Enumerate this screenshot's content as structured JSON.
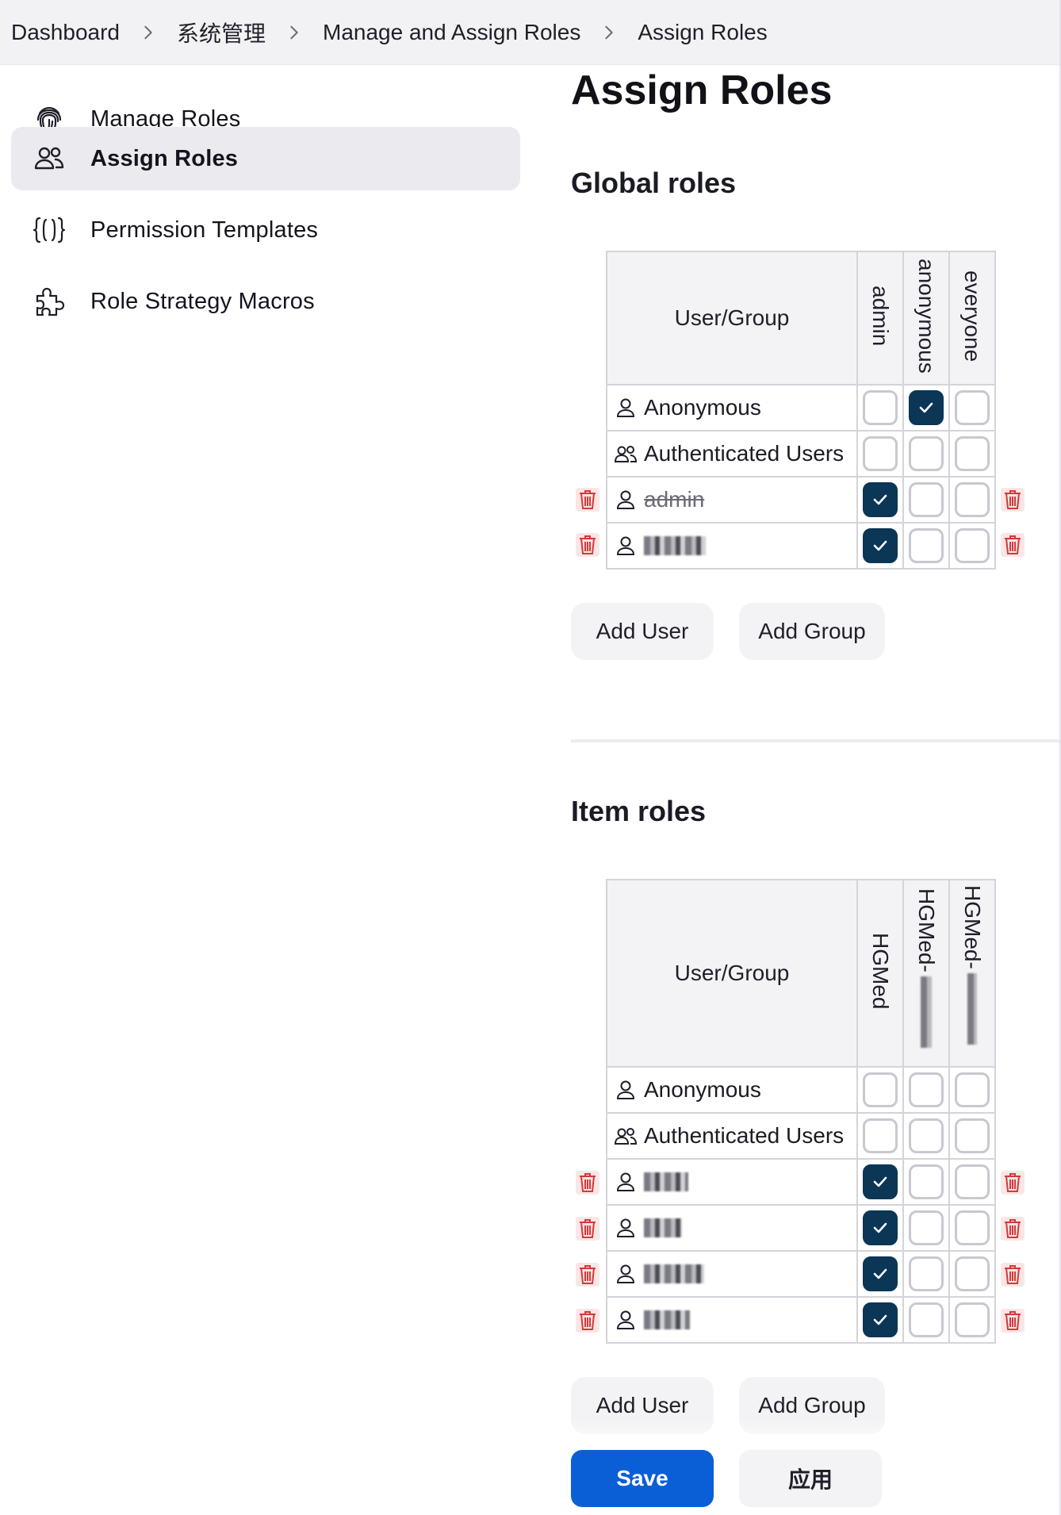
{
  "breadcrumb": {
    "items": [
      "Dashboard",
      "系统管理",
      "Manage and Assign Roles",
      "Assign Roles"
    ]
  },
  "sidebar": {
    "items": [
      {
        "label": "Manage Roles",
        "icon": "fingerprint-icon",
        "active": false
      },
      {
        "label": "Assign Roles",
        "icon": "users-icon",
        "active": true
      },
      {
        "label": "Permission Templates",
        "icon": "braces-icon",
        "active": false
      },
      {
        "label": "Role Strategy Macros",
        "icon": "puzzle-icon",
        "active": false
      }
    ]
  },
  "main": {
    "title": "Assign Roles",
    "global": {
      "title": "Global roles",
      "user_header": "User/Group",
      "roles": [
        "admin",
        "anonymous",
        "everyone"
      ],
      "rows": [
        {
          "name": "Anonymous",
          "type": "user",
          "checks": [
            false,
            true,
            false
          ],
          "deletable": false,
          "strike": false,
          "blurred": false
        },
        {
          "name": "Authenticated Users",
          "type": "group",
          "checks": [
            false,
            false,
            false
          ],
          "deletable": false,
          "strike": false,
          "blurred": false
        },
        {
          "name": "admin",
          "type": "user",
          "checks": [
            true,
            false,
            false
          ],
          "deletable": true,
          "strike": true,
          "blurred": false
        },
        {
          "name": "",
          "type": "user",
          "checks": [
            true,
            false,
            false
          ],
          "deletable": true,
          "strike": false,
          "blurred": true
        }
      ],
      "add_user": "Add User",
      "add_group": "Add Group"
    },
    "item": {
      "title": "Item roles",
      "user_header": "User/Group",
      "roles": [
        "HGMed",
        "HGMed-",
        "HGMed-"
      ],
      "rows": [
        {
          "name": "Anonymous",
          "type": "user",
          "checks": [
            false,
            false,
            false
          ],
          "deletable": false,
          "strike": false,
          "blurred": false
        },
        {
          "name": "Authenticated Users",
          "type": "group",
          "checks": [
            false,
            false,
            false
          ],
          "deletable": false,
          "strike": false,
          "blurred": false
        },
        {
          "name": "",
          "type": "user",
          "checks": [
            true,
            false,
            false
          ],
          "deletable": true,
          "strike": false,
          "blurred": true
        },
        {
          "name": "",
          "type": "user",
          "checks": [
            true,
            false,
            false
          ],
          "deletable": true,
          "strike": false,
          "blurred": true
        },
        {
          "name": "",
          "type": "user",
          "checks": [
            true,
            false,
            false
          ],
          "deletable": true,
          "strike": false,
          "blurred": true
        },
        {
          "name": "",
          "type": "user",
          "checks": [
            true,
            false,
            false
          ],
          "deletable": true,
          "strike": false,
          "blurred": true
        }
      ],
      "add_user": "Add User",
      "add_group": "Add Group"
    },
    "save_label": "Save",
    "apply_label": "应用"
  },
  "colors": {
    "checked": "#0b3655",
    "primary": "#0b5fd6",
    "danger": "#d33a3a",
    "active_bg": "#ebebef"
  }
}
